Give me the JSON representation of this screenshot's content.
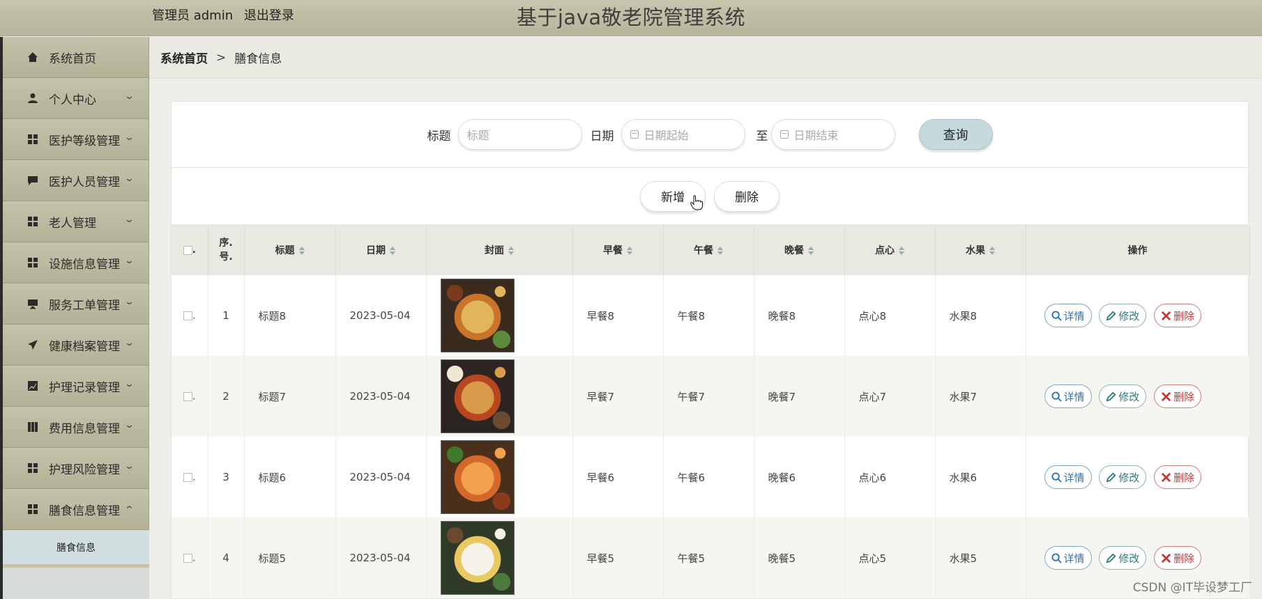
{
  "header": {
    "admin_label": "管理员 admin",
    "logout_label": "退出登录",
    "site_title": "基于java敬老院管理系统"
  },
  "sidebar": {
    "items": [
      {
        "label": "系统首页",
        "icon": "home-icon"
      },
      {
        "label": "个人中心",
        "icon": "user-icon"
      },
      {
        "label": "医护等级管理",
        "icon": "grid-icon"
      },
      {
        "label": "医护人员管理",
        "icon": "message-icon"
      },
      {
        "label": "老人管理",
        "icon": "grid-icon"
      },
      {
        "label": "设施信息管理",
        "icon": "grid-icon"
      },
      {
        "label": "服务工单管理",
        "icon": "monitor-icon"
      },
      {
        "label": "健康档案管理",
        "icon": "send-icon"
      },
      {
        "label": "护理记录管理",
        "icon": "chart-icon"
      },
      {
        "label": "费用信息管理",
        "icon": "book-icon"
      },
      {
        "label": "护理风险管理",
        "icon": "grid-icon"
      },
      {
        "label": "膳食信息管理",
        "icon": "grid-icon"
      }
    ],
    "sub_item": "膳食信息"
  },
  "breadcrumb": {
    "home": "系统首页",
    "separator": ">",
    "current": "膳食信息"
  },
  "search": {
    "title_label": "标题",
    "title_placeholder": "标题",
    "date_label": "日期",
    "date_start_placeholder": "日期起始",
    "to_label": "至",
    "date_end_placeholder": "日期结束",
    "query_label": "查询"
  },
  "actions": {
    "add_label": "新增",
    "delete_label": "删除"
  },
  "table": {
    "headers": [
      "序.号.",
      "标题",
      "日期",
      "封面",
      "早餐",
      "午餐",
      "晚餐",
      "点心",
      "水果",
      "操作"
    ],
    "op_labels": {
      "detail": "详情",
      "edit": "修改",
      "delete": "删除"
    },
    "rows": [
      {
        "no": "1",
        "title": "标题8",
        "date": "2023-05-04",
        "breakfast": "早餐8",
        "lunch": "午餐8",
        "dinner": "晚餐8",
        "snack": "点心8",
        "fruit": "水果8"
      },
      {
        "no": "2",
        "title": "标题7",
        "date": "2023-05-04",
        "breakfast": "早餐7",
        "lunch": "午餐7",
        "dinner": "晚餐7",
        "snack": "点心7",
        "fruit": "水果7"
      },
      {
        "no": "3",
        "title": "标题6",
        "date": "2023-05-04",
        "breakfast": "早餐6",
        "lunch": "午餐6",
        "dinner": "晚餐6",
        "snack": "点心6",
        "fruit": "水果6"
      },
      {
        "no": "4",
        "title": "标题5",
        "date": "2023-05-04",
        "breakfast": "早餐5",
        "lunch": "午餐5",
        "dinner": "晚餐5",
        "snack": "点心5",
        "fruit": "水果5"
      }
    ]
  },
  "watermark": "CSDN @IT毕设梦工厂"
}
